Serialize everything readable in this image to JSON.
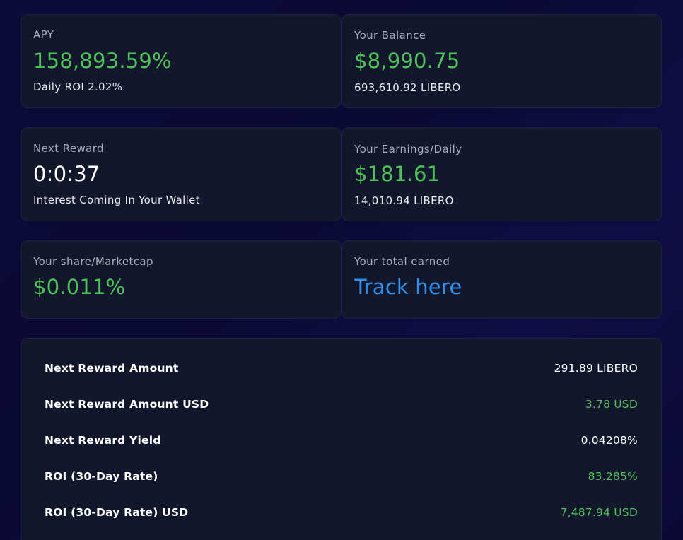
{
  "cards": {
    "apy": {
      "label": "APY",
      "value": "158,893.59%",
      "sub": "Daily ROI 2.02%"
    },
    "balance": {
      "label": "Your Balance",
      "value": "$8,990.75",
      "sub": "693,610.92 LIBERO"
    },
    "next_reward": {
      "label": "Next Reward",
      "value": "0:0:37",
      "sub": "Interest Coming In Your Wallet"
    },
    "earnings": {
      "label": "Your Earnings/Daily",
      "value": "$181.61",
      "sub": "14,010.94 LIBERO"
    },
    "share": {
      "label": "Your share/Marketcap",
      "value": "$0.011%"
    },
    "total_earned": {
      "label": "Your total earned",
      "link": "Track here"
    }
  },
  "rows": [
    {
      "label": "Next Reward Amount",
      "value": "291.89 LIBERO",
      "color": "#ffffff"
    },
    {
      "label": "Next Reward Amount USD",
      "value": "3.78 USD",
      "color": "#4fc15a"
    },
    {
      "label": "Next Reward Yield",
      "value": "0.04208%",
      "color": "#ffffff"
    },
    {
      "label": "ROI (30-Day Rate)",
      "value": "83.285%",
      "color": "#4fc15a"
    },
    {
      "label": "ROI (30-Day Rate) USD",
      "value": "7,487.94 USD",
      "color": "#4fc15a"
    }
  ],
  "colors": {
    "accent_green": "#4fc15a",
    "link_blue": "#2f8fe8",
    "card_bg": "#12172b",
    "page_bg": "#0d0b3a"
  }
}
